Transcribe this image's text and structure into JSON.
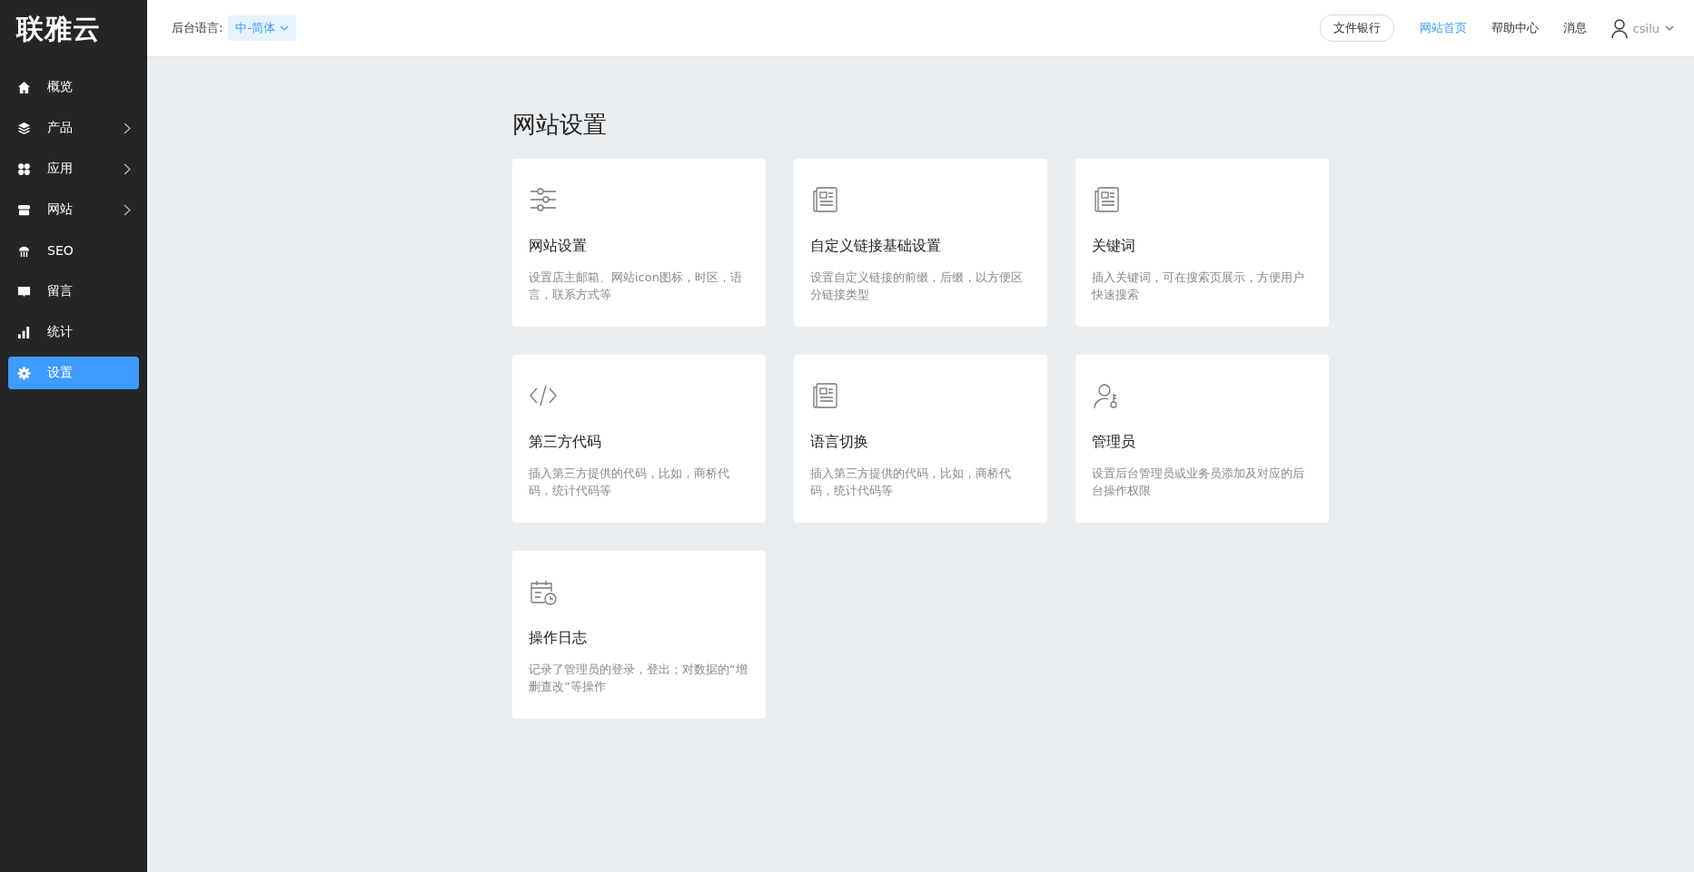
{
  "brand": {
    "logo": "联雅云"
  },
  "sidebar": {
    "items": [
      {
        "label": "概览",
        "kind": "home",
        "has_submenu": false,
        "selected": false
      },
      {
        "label": "产品",
        "kind": "layers",
        "has_submenu": true,
        "selected": false
      },
      {
        "label": "应用",
        "kind": "apps",
        "has_submenu": true,
        "selected": false
      },
      {
        "label": "网站",
        "kind": "store",
        "has_submenu": true,
        "selected": false
      },
      {
        "label": "SEO",
        "kind": "seo",
        "has_submenu": false,
        "selected": false
      },
      {
        "label": "留言",
        "kind": "message",
        "has_submenu": false,
        "selected": false
      },
      {
        "label": "统计",
        "kind": "chart",
        "has_submenu": false,
        "selected": false
      },
      {
        "label": "设置",
        "kind": "gear",
        "has_submenu": false,
        "selected": true
      }
    ]
  },
  "header": {
    "language_label": "后台语言:",
    "language_value": "中-简体",
    "file_bank": "文件银行",
    "links": [
      {
        "label": "网站首页",
        "selected": true
      },
      {
        "label": "帮助中心",
        "selected": false
      },
      {
        "label": "消息",
        "selected": false
      }
    ],
    "user": "csilu"
  },
  "page": {
    "title": "网站设置",
    "cards": [
      {
        "kind": "sliders",
        "title": "网站设置",
        "description": "设置店主邮箱、网站icon图标，时区，语言，联系方式等"
      },
      {
        "kind": "newspaper",
        "title": "自定义链接基础设置",
        "description": "设置自定义链接的前缀，后缀，以方便区分链接类型"
      },
      {
        "kind": "newspaper",
        "title": "关键词",
        "description": "插入关键词，可在搜索页展示，方便用户快速搜索"
      },
      {
        "kind": "code",
        "title": "第三方代码",
        "description": "插入第三方提供的代码，比如，商桥代码，统计代码等"
      },
      {
        "kind": "newspaper",
        "title": "语言切换",
        "description": "插入第三方提供的代码，比如，商桥代码，统计代码等"
      },
      {
        "kind": "user-key",
        "title": "管理员",
        "description": "设置后台管理员或业务员添加及对应的后台操作权限"
      },
      {
        "kind": "calendar-clock",
        "title": "操作日志",
        "description": "记录了管理员的登录，登出；对数据的“增删查改”等操作"
      }
    ]
  }
}
